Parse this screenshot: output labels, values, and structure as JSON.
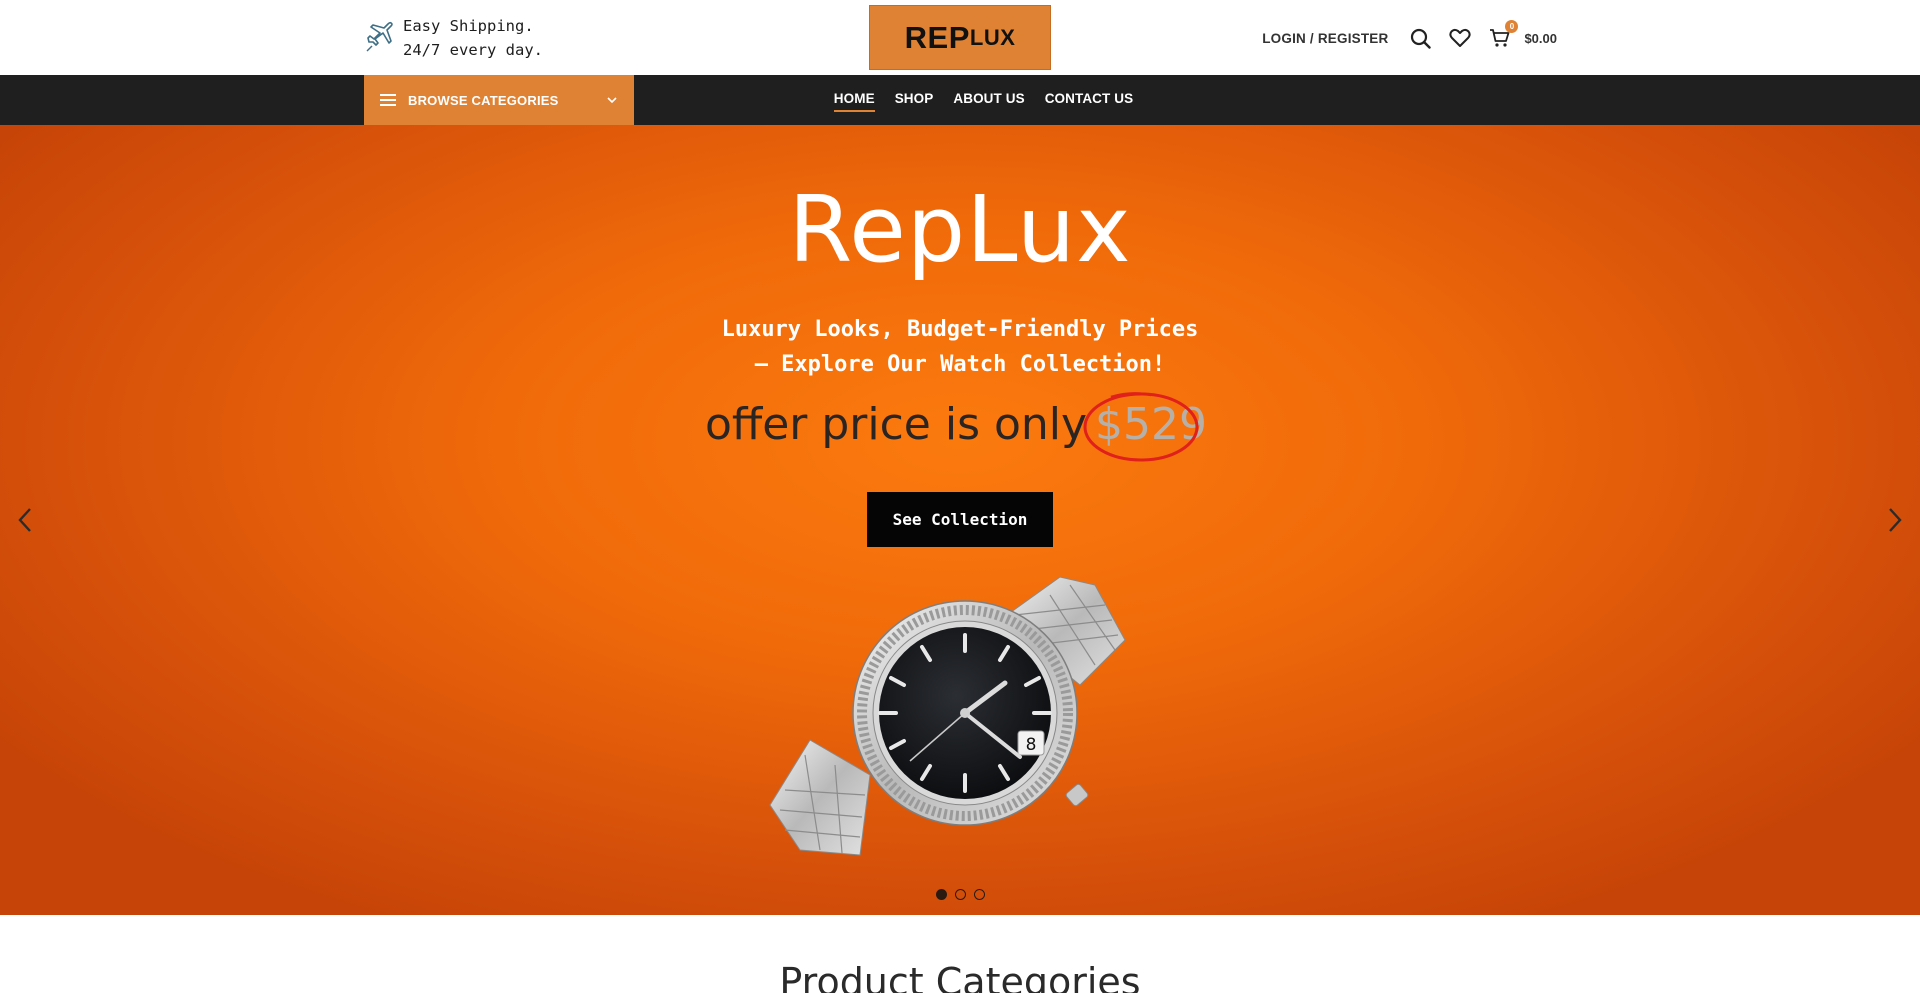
{
  "header": {
    "shipping_line1": "Easy Shipping.",
    "shipping_line2": "24/7 every day.",
    "logo_rep": "REP",
    "logo_lux": "LUX",
    "login_label": "LOGIN / REGISTER",
    "cart_count": "0",
    "cart_total": "$0.00",
    "icons": [
      "plane-icon",
      "search-icon",
      "heart-icon",
      "cart-icon"
    ]
  },
  "nav": {
    "browse_label": "BROWSE CATEGORIES",
    "items": [
      {
        "label": "HOME",
        "active": true
      },
      {
        "label": "SHOP",
        "active": false
      },
      {
        "label": "ABOUT US",
        "active": false
      },
      {
        "label": "CONTACT US",
        "active": false
      }
    ]
  },
  "hero": {
    "title": "RepLux",
    "subtitle_line1": "Luxury Looks, Budget-Friendly Prices",
    "subtitle_line2": "– Explore Our Watch Collection!",
    "offer_text": "offer price is only",
    "offer_price": "$529",
    "cta_label": "See Collection",
    "slides": 3,
    "active_slide": 1
  },
  "sections": {
    "product_categories_title": "Product Categories"
  },
  "colors": {
    "accent": "#df8234",
    "nav_bg": "#1f1f1f",
    "hero_orange": "#f06a0a",
    "price_circle": "#e0201a"
  }
}
